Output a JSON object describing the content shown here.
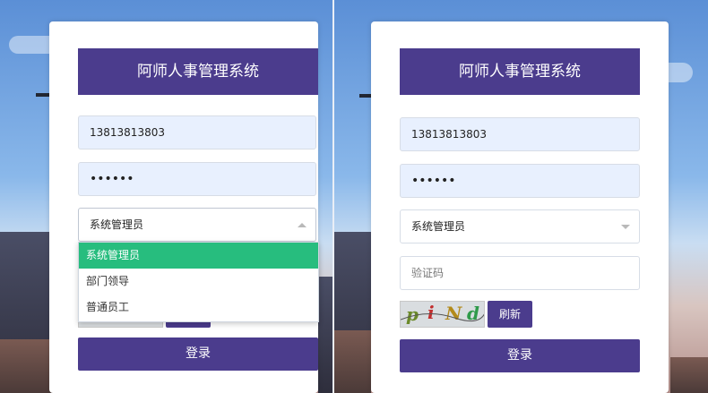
{
  "left_panel": {
    "title": "阿师人事管理系统",
    "phone_value": "13813813803",
    "password_masked": "••••••",
    "role_selected": "系统管理员",
    "role_options": [
      "系统管理员",
      "部门领导",
      "普通员工"
    ],
    "login_label": "登录"
  },
  "right_panel": {
    "title": "阿师人事管理系统",
    "phone_value": "13813813803",
    "password_masked": "••••••",
    "role_selected": "系统管理员",
    "captcha_placeholder": "验证码",
    "captcha_chars": [
      "p",
      "i",
      "N",
      "d"
    ],
    "refresh_label": "刷新",
    "login_label": "登录"
  },
  "colors": {
    "brand": "#4b3c8d",
    "selected_option": "#27bd7e",
    "autofill_bg": "#e8f0fe"
  }
}
